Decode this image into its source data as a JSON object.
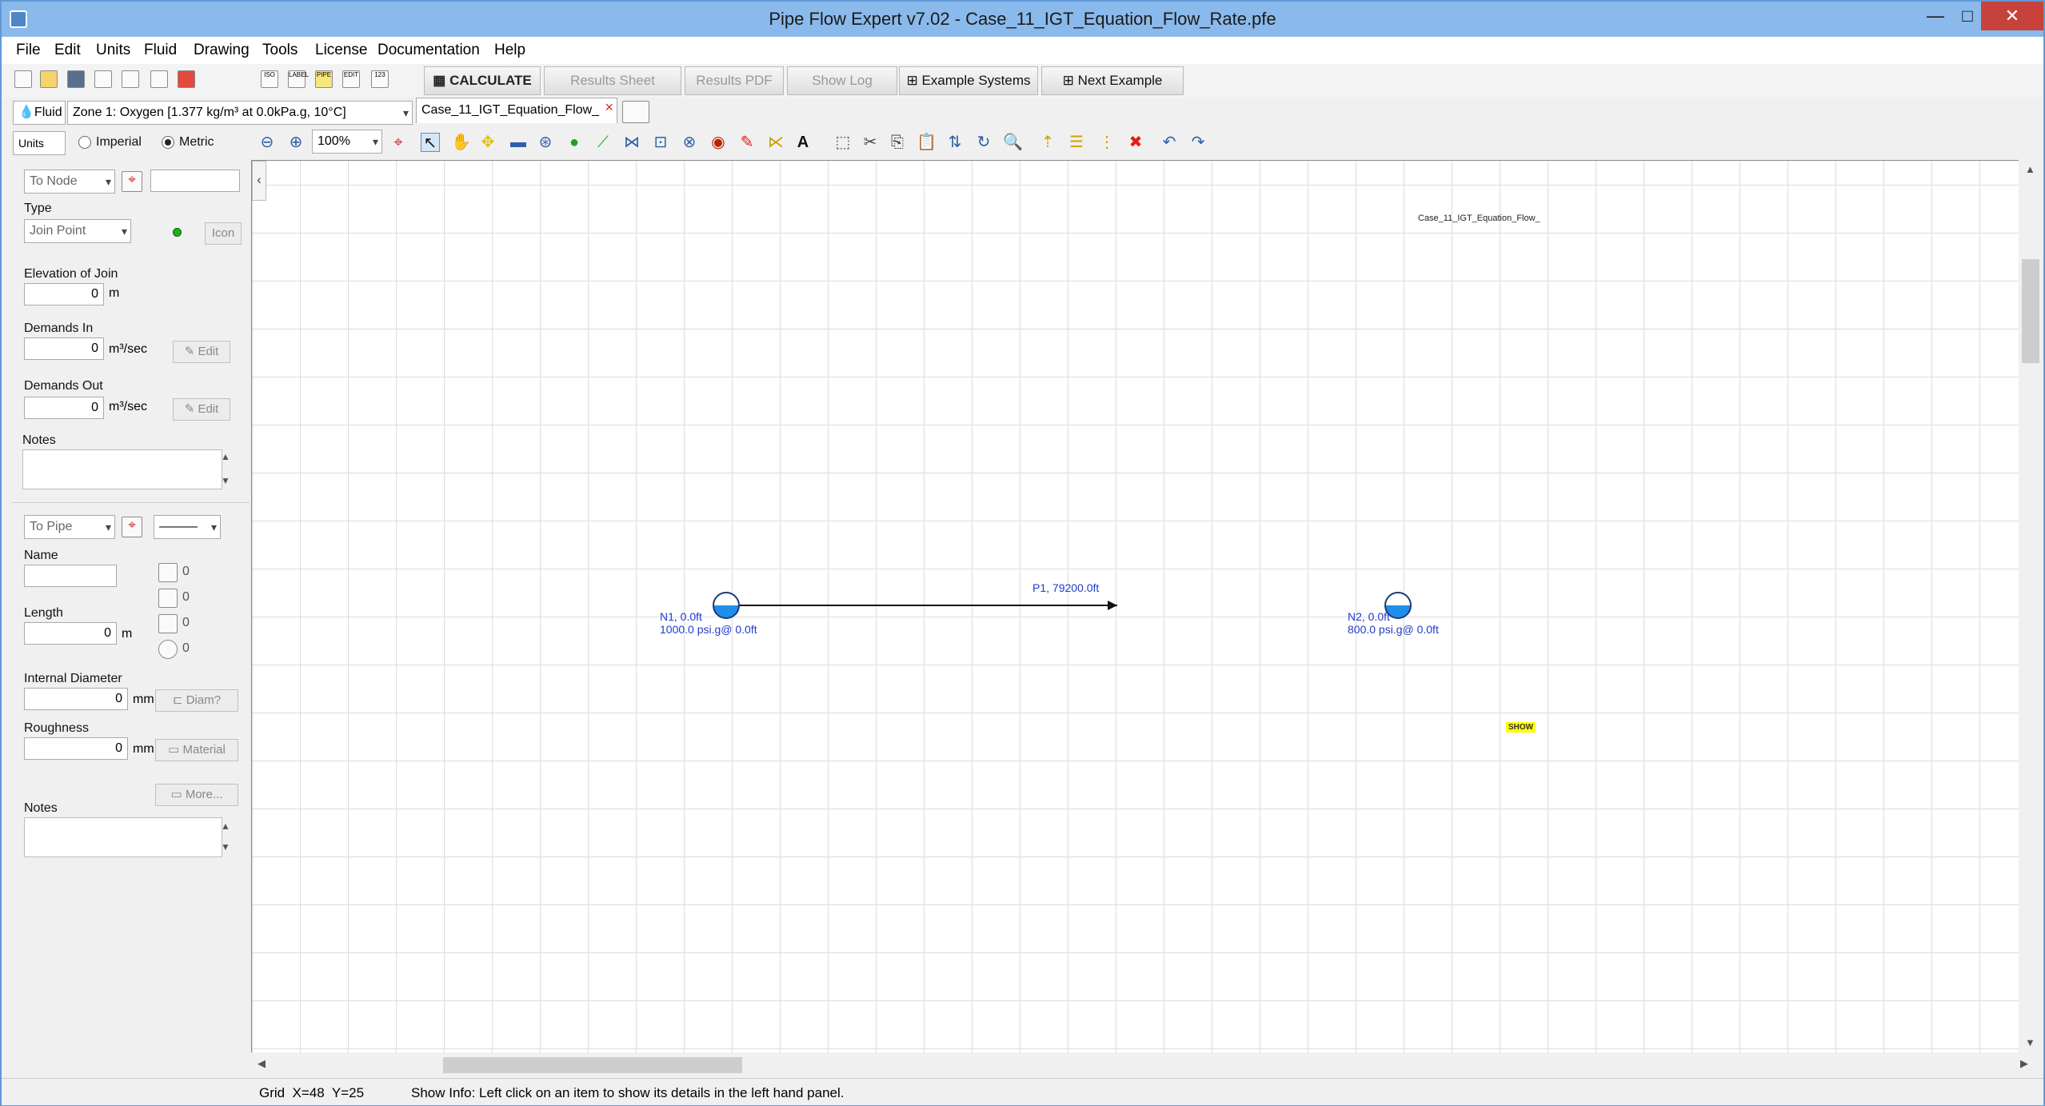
{
  "window": {
    "title_prefix": "Pipe Flow Expert v7.02 - Case_11_",
    "title_bold": "IGT_Equation_Flow_Rate",
    "title_suffix": ".pfe",
    "minimize": "—",
    "maximize": "□",
    "close": "✕"
  },
  "menu": [
    "File",
    "Edit",
    "Units",
    "Fluid",
    "Drawing",
    "Tools",
    "License",
    "Documentation",
    "Help"
  ],
  "toolbar1": {
    "calculate": "CALCULATE",
    "results_sheet": "Results Sheet",
    "results_pdf": "Results PDF",
    "show_log": "Show Log",
    "example_systems": "Example Systems",
    "next_example": "Next Example",
    "mini_labels": [
      "ISO",
      "LABEL",
      "PIPE",
      "EDIT",
      "123"
    ]
  },
  "fluid": {
    "button": "Fluid",
    "zone": "Zone 1: Oxygen [1.377 kg/m³ at 0.0kPa.g, 10°C]",
    "doc_tab": "Case_11_IGT_Equation_Flow_"
  },
  "units": {
    "button": "Units",
    "imperial": "Imperial",
    "metric": "Metric",
    "selected": "Metric",
    "zoom": "100%"
  },
  "node_panel": {
    "to_node": "To Node",
    "type_label": "Type",
    "type_value": "Join Point",
    "icon_btn": "Icon",
    "elevation_label": "Elevation of Join",
    "elevation_value": "0",
    "elevation_unit": "m",
    "demands_in_label": "Demands In",
    "demands_in_value": "0",
    "demands_in_unit": "m³/sec",
    "demands_out_label": "Demands Out",
    "demands_out_value": "0",
    "demands_out_unit": "m³/sec",
    "edit_btn": "Edit",
    "notes_label": "Notes"
  },
  "pipe_panel": {
    "to_pipe": "To Pipe",
    "name_label": "Name",
    "length_label": "Length",
    "length_value": "0",
    "length_unit": "m",
    "diameter_label": "Internal Diameter",
    "diameter_value": "0",
    "diameter_unit": "mm",
    "diam_btn": "Diam?",
    "roughness_label": "Roughness",
    "roughness_value": "0",
    "roughness_unit": "mm",
    "material_btn": "Material",
    "more_btn": "More...",
    "notes_label": "Notes",
    "counts": [
      "0",
      "0",
      "0",
      "0"
    ]
  },
  "canvas": {
    "doc_label": "Case_11_IGT_Equation_Flow_",
    "pipe_label": "P1, 79200.0ft",
    "n1_line1": "N1, 0.0ft",
    "n1_line2": "1000.0 psi.g@ 0.0ft",
    "n2_line1": "N2, 0.0ft",
    "n2_line2": "800.0 psi.g@ 0.0ft",
    "show_tag": "SHOW"
  },
  "status": {
    "grid": "Grid  X=48  Y=25",
    "info": "Show Info: Left click on an item to show its details in the left hand panel."
  }
}
